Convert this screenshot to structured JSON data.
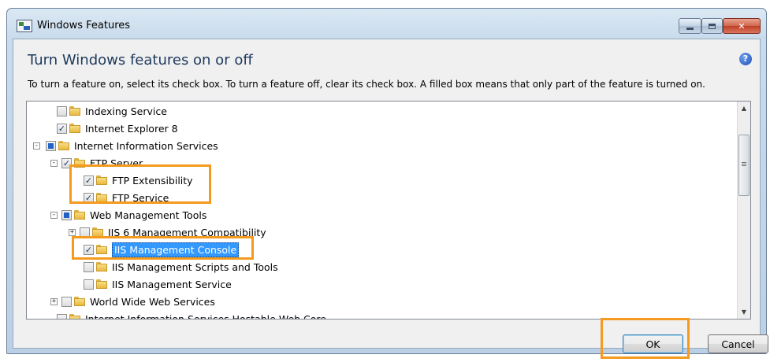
{
  "window": {
    "title": "Windows Features",
    "icon": "windows-features-icon",
    "controls": [
      "minimize-icon",
      "maximize-icon",
      "close-icon"
    ]
  },
  "header": {
    "title": "Turn Windows features on or off",
    "help_icon": "help-icon",
    "help_glyph": "?",
    "description": "To turn a feature on, select its check box. To turn a feature off, clear its check box. A filled box means that only part of the feature is turned on."
  },
  "tree": {
    "items": [
      {
        "label": "Indexing Service",
        "state": "unchecked",
        "expander": ""
      },
      {
        "label": "Internet Explorer 8",
        "state": "checked",
        "expander": ""
      },
      {
        "label": "Internet Information Services",
        "state": "partial",
        "expander": "-"
      },
      {
        "label": "FTP Server",
        "state": "checked",
        "expander": "-"
      },
      {
        "label": "FTP Extensibility",
        "state": "checked",
        "expander": ""
      },
      {
        "label": "FTP Service",
        "state": "checked",
        "expander": ""
      },
      {
        "label": "Web Management Tools",
        "state": "partial",
        "expander": "-"
      },
      {
        "label": "IIS 6 Management Compatibility",
        "state": "unchecked",
        "expander": "+"
      },
      {
        "label": "IIS Management Console",
        "state": "checked",
        "expander": "",
        "selected": true
      },
      {
        "label": "IIS Management Scripts and Tools",
        "state": "unchecked",
        "expander": ""
      },
      {
        "label": "IIS Management Service",
        "state": "unchecked",
        "expander": ""
      },
      {
        "label": "World Wide Web Services",
        "state": "unchecked",
        "expander": "+"
      },
      {
        "label": "Internet Information Services Hostable Web Core",
        "state": "unchecked",
        "expander": ""
      }
    ]
  },
  "scrollbar": {
    "up_glyph": "▲",
    "down_glyph": "▼"
  },
  "buttons": {
    "ok": "OK",
    "cancel": "Cancel"
  },
  "highlight_color": "#f39a1f",
  "selection_color": "#3399ff"
}
